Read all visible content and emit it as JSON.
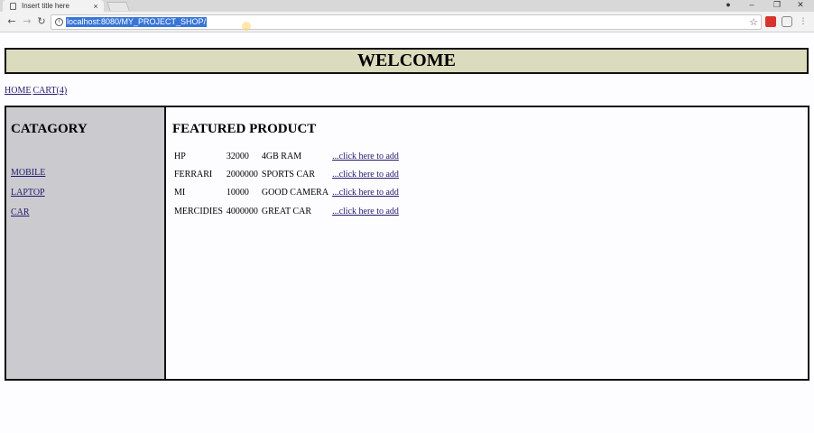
{
  "browser": {
    "tab_title": "Insert title here",
    "tab_close": "×",
    "url": "localhost:8080/MY_PROJECT_SHOP/",
    "info_glyph": "i",
    "back_glyph": "←",
    "forward_glyph": "→",
    "reload_glyph": "↻",
    "star_glyph": "☆",
    "minimize_glyph": "–",
    "restore_glyph": "❐",
    "close_glyph": "✕",
    "profile_glyph": "●"
  },
  "header": {
    "title": "WELCOME"
  },
  "topnav": {
    "home": "HOME",
    "cart": "CART(4)"
  },
  "sidebar": {
    "title": "CATAGORY",
    "items": [
      "MOBILE",
      "LAPTOP",
      "CAR"
    ]
  },
  "main": {
    "title": "FEATURED PRODUCT",
    "products": [
      {
        "name": "HP",
        "price": "32000",
        "desc": "4GB RAM",
        "action": "...click here to add"
      },
      {
        "name": "FERRARI",
        "price": "2000000",
        "desc": "SPORTS CAR",
        "action": "...click here to add"
      },
      {
        "name": "MI",
        "price": "10000",
        "desc": "GOOD CAMERA",
        "action": "...click here to add"
      },
      {
        "name": "MERCIDIES",
        "price": "4000000",
        "desc": "GREAT CAR",
        "action": "...click here to add"
      }
    ]
  },
  "colors": {
    "header_bg": "#dbdbbd",
    "sidebar_bg": "#cbcbcf",
    "link": "#221a6e",
    "url_highlight": "#3875d7"
  }
}
